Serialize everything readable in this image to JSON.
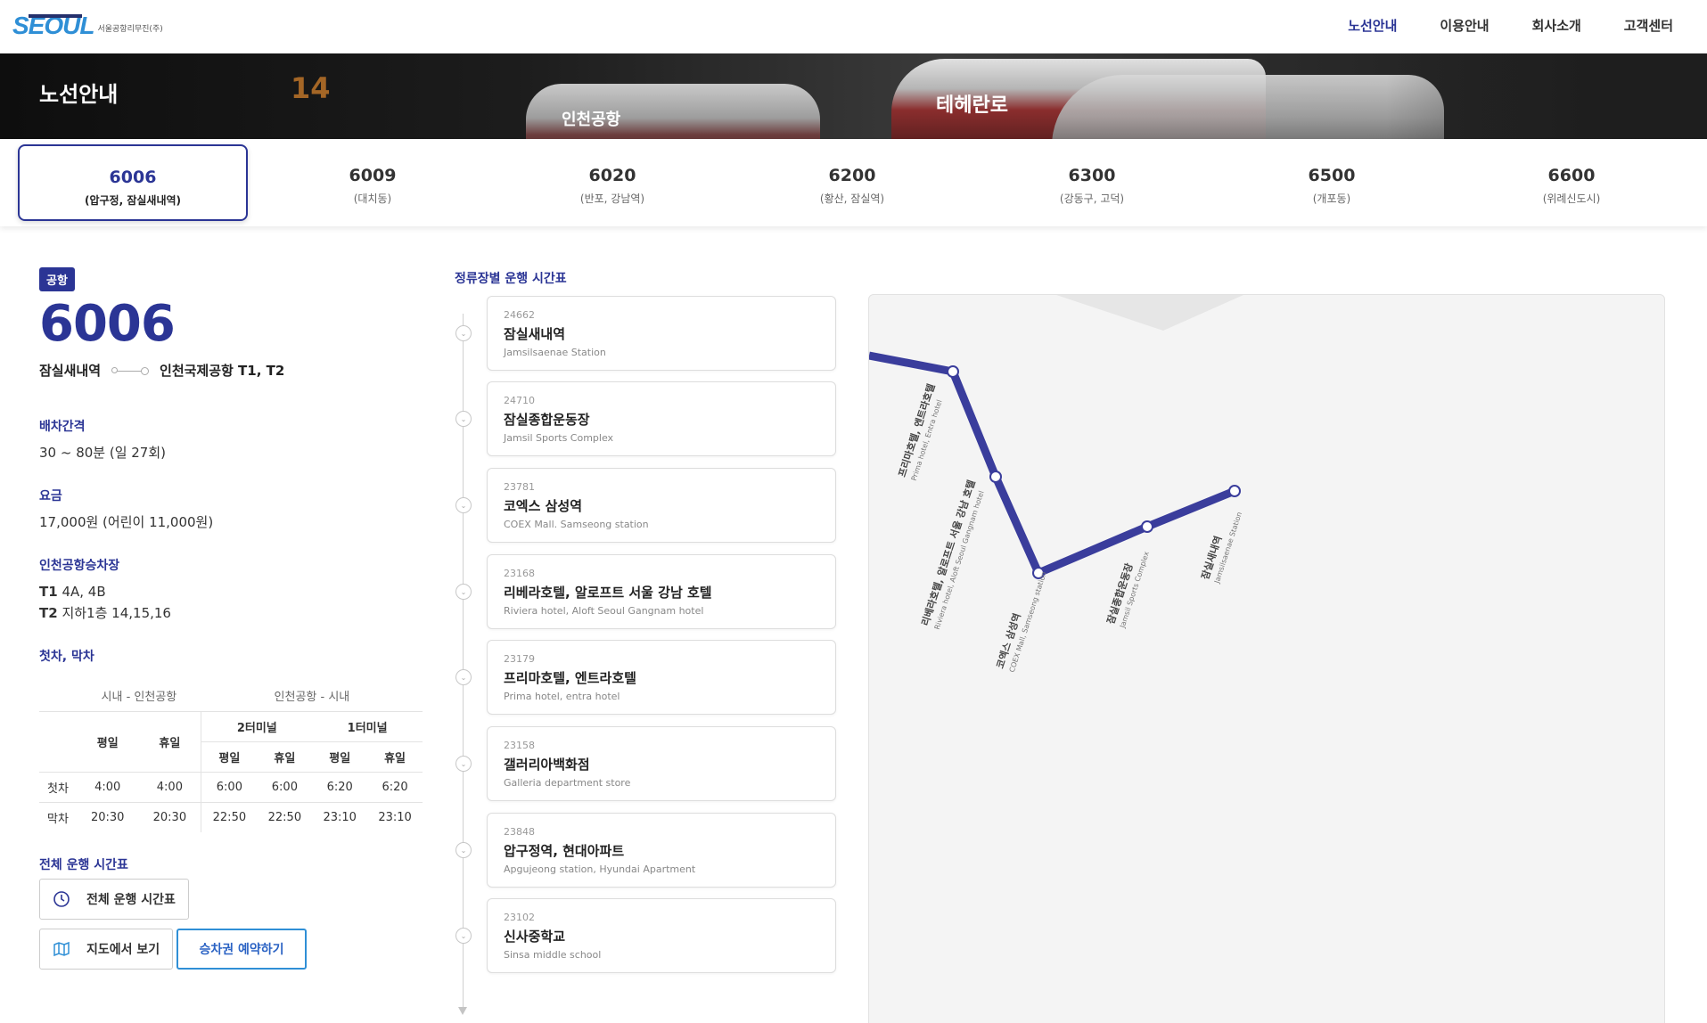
{
  "header": {
    "logo_text": "SEOUL",
    "logo_sub": "서울공항리무진(주)",
    "nav": [
      {
        "label": "노선안내",
        "active": true
      },
      {
        "label": "이용안내",
        "active": false
      },
      {
        "label": "회사소개",
        "active": false
      },
      {
        "label": "고객센터",
        "active": false
      }
    ]
  },
  "hero": {
    "title": "노선안내",
    "bg_number": "14",
    "bus_texts": [
      "인천공항",
      "테헤란로"
    ]
  },
  "tabs": [
    {
      "number": "6006",
      "sub": "(압구정, 잠실새내역)",
      "active": true
    },
    {
      "number": "6009",
      "sub": "(대치동)",
      "active": false
    },
    {
      "number": "6020",
      "sub": "(반포, 강남역)",
      "active": false
    },
    {
      "number": "6200",
      "sub": "(황산, 잠실역)",
      "active": false
    },
    {
      "number": "6300",
      "sub": "(강동구, 고덕)",
      "active": false
    },
    {
      "number": "6500",
      "sub": "(개포동)",
      "active": false
    },
    {
      "number": "6600",
      "sub": "(위례신도시)",
      "active": false
    }
  ],
  "route": {
    "badge": "공항",
    "number": "6006",
    "from": "잠실새내역",
    "to": "인천국제공항 T1, T2",
    "interval_label": "배차간격",
    "interval_value": "30 ~ 80분 (일 27회)",
    "fare_label": "요금",
    "fare_value": "17,000원 (어린이 11,000원)",
    "boarding_label": "인천공항승차장",
    "t1_label": "T1",
    "t1_value": "4A, 4B",
    "t2_label": "T2",
    "t2_value": "지하1층 14,15,16",
    "firstlast_label": "첫차, 막차"
  },
  "schedule": {
    "group_city_airport": "시내 - 인천공항",
    "group_airport_city": "인천공항 - 시내",
    "weekday": "평일",
    "holiday": "휴일",
    "t2": "2터미널",
    "t1": "1터미널",
    "rows": [
      {
        "label": "첫차",
        "values": [
          "4:00",
          "4:00",
          "6:00",
          "6:00",
          "6:20",
          "6:20"
        ]
      },
      {
        "label": "막차",
        "values": [
          "20:30",
          "20:30",
          "22:50",
          "22:50",
          "23:10",
          "23:10"
        ]
      }
    ]
  },
  "full_schedule": {
    "label": "전체 운행 시간표",
    "button": "전체 운행 시간표",
    "map_button": "지도에서 보기",
    "reserve_button": "승차권 예약하기"
  },
  "timeline": {
    "title": "정류장별 운행 시간표",
    "stops": [
      {
        "code": "24662",
        "name": "잠실새내역",
        "en": "Jamsilsaenae Station"
      },
      {
        "code": "24710",
        "name": "잠실종합운동장",
        "en": "Jamsil Sports Complex"
      },
      {
        "code": "23781",
        "name": "코엑스 삼성역",
        "en": "COEX Mall. Samseong station"
      },
      {
        "code": "23168",
        "name": "리베라호텔, 알로프트 서울 강남 호텔",
        "en": "Riviera hotel, Aloft Seoul Gangnam hotel"
      },
      {
        "code": "23179",
        "name": "프리마호텔, 엔트라호텔",
        "en": "Prima hotel, entra hotel"
      },
      {
        "code": "23158",
        "name": "갤러리아백화점",
        "en": "Galleria department store"
      },
      {
        "code": "23848",
        "name": "압구정역, 현대아파트",
        "en": "Apgujeong station, Hyundai Apartment"
      },
      {
        "code": "23102",
        "name": "신사중학교",
        "en": "Sinsa middle school"
      }
    ]
  },
  "map": {
    "line_color": "#3a3d9c",
    "labels": [
      {
        "ko": "프리마호텔, 엔트라호텔",
        "en": "Prima hotel, Entra hotel"
      },
      {
        "ko": "리베라호텔, 알로프트 서울 강남 호텔",
        "en": "Riviera hotel, Aloft Seoul Gangnam hotel"
      },
      {
        "ko": "코엑스 삼성역",
        "en": "COEX Mall, Samseong station"
      },
      {
        "ko": "잠실종합운동장",
        "en": "Jamsil Sports Complex"
      },
      {
        "ko": "잠실새내역",
        "en": "Jamsilsaenae Station"
      }
    ]
  },
  "colors": {
    "brand": "#2b3595",
    "accent": "#2f8fd6"
  }
}
